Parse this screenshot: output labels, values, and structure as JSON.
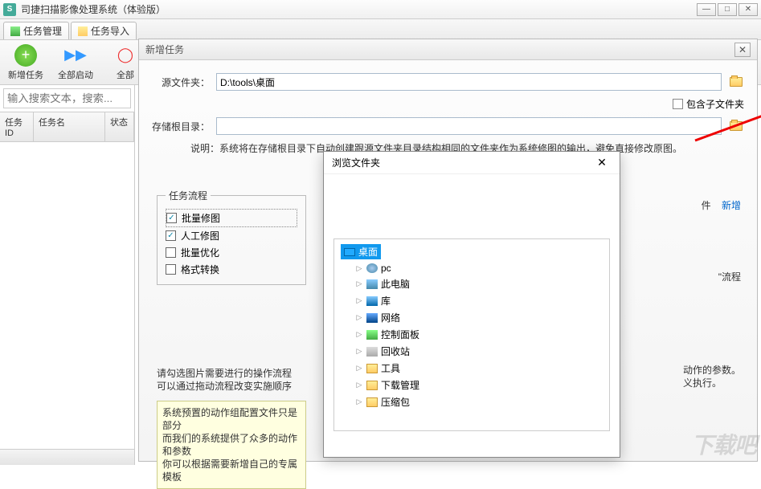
{
  "titlebar": {
    "title": "司捷扫描影像处理系统（体验版）",
    "logo_letter": "S"
  },
  "tabs": [
    {
      "label": "任务管理",
      "color": "#3a3"
    },
    {
      "label": "任务导入",
      "color": "#c90"
    }
  ],
  "toolbar": {
    "new_task": "新增任务",
    "start_all": "全部启动",
    "stop_all": "全部"
  },
  "search": {
    "placeholder": "输入搜索文本，搜索..."
  },
  "task_table": {
    "cols": [
      "任务ID",
      "任务名",
      "状态"
    ]
  },
  "panel": {
    "title": "新增任务",
    "src_label": "源文件夹：",
    "src_value": "D:\\tools\\桌面",
    "include_sub": "包含子文件夹",
    "store_label": "存储根目录：",
    "store_value": "",
    "note_prefix": "说明：",
    "note": "系统将在存储根目录下自动创建跟源文件夹目录结构相同的文件夹作为系统修图的输出，避免直接修改原图。",
    "flows_legend": "任务流程",
    "flows": [
      {
        "label": "批量修图",
        "checked": true,
        "selected": true
      },
      {
        "label": "人工修图",
        "checked": true,
        "selected": false
      },
      {
        "label": "批量优化",
        "checked": false,
        "selected": false
      },
      {
        "label": "格式转换",
        "checked": false,
        "selected": false
      }
    ],
    "hint1": "请勾选图片需要进行的操作流程",
    "hint2": "可以通过拖动流程改变实施顺序",
    "yellow1": "系统预置的动作组配置文件只是部分",
    "yellow2": "而我们的系统提供了众多的动作和参数",
    "yellow3": "你可以根据需要新增自己的专属模板",
    "right_links_file": "件",
    "right_links_new": "新增",
    "right_txt_flow": "\"流程",
    "right_txt_params1": "动作的参数。",
    "right_txt_params2": "义执行。"
  },
  "browse": {
    "title": "浏览文件夹",
    "root": "桌面",
    "items": [
      {
        "label": "pc",
        "icon": "ico-user"
      },
      {
        "label": "此电脑",
        "icon": "ico-pc"
      },
      {
        "label": "库",
        "icon": "ico-lib"
      },
      {
        "label": "网络",
        "icon": "ico-net"
      },
      {
        "label": "控制面板",
        "icon": "ico-cpl"
      },
      {
        "label": "回收站",
        "icon": "ico-bin"
      },
      {
        "label": "工具",
        "icon": "ico-folder"
      },
      {
        "label": "下载管理",
        "icon": "ico-folder"
      },
      {
        "label": "压缩包",
        "icon": "ico-folder"
      }
    ]
  },
  "watermark": "下载吧"
}
